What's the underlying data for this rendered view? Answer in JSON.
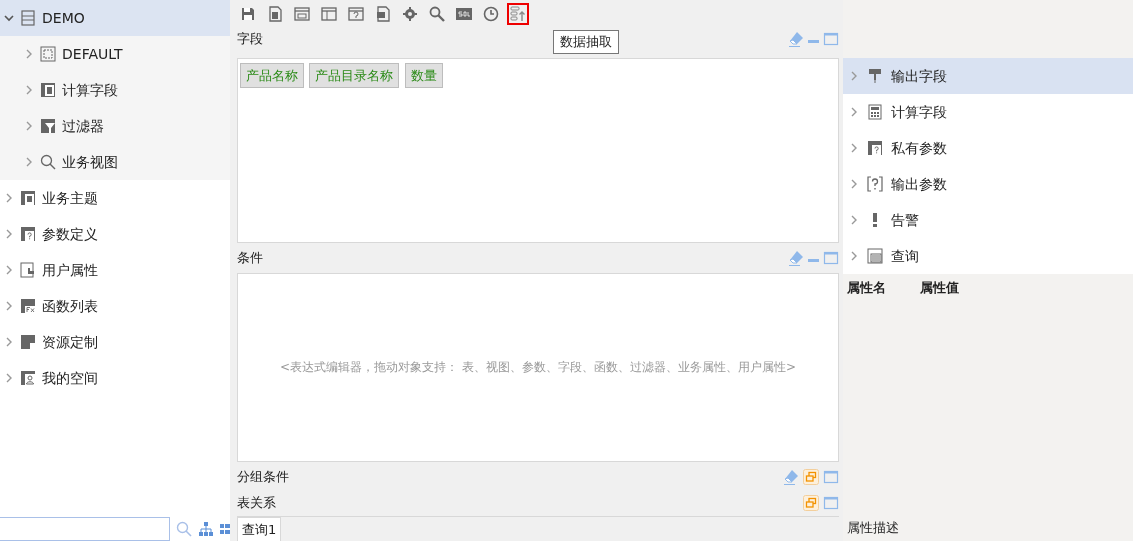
{
  "sidebar": {
    "tree": [
      {
        "label": "DEMO",
        "expanded": true,
        "selected": true,
        "children": [
          {
            "label": "DEFAULT",
            "expanded": false,
            "selected": false
          },
          {
            "label": "计算字段",
            "expanded": false,
            "selected": false
          },
          {
            "label": "过滤器",
            "expanded": false,
            "selected": false
          },
          {
            "label": "业务视图",
            "expanded": false,
            "selected": false
          }
        ]
      },
      {
        "label": "业务主题",
        "expanded": false,
        "selected": false
      },
      {
        "label": "参数定义",
        "expanded": false,
        "selected": false
      },
      {
        "label": "用户属性",
        "expanded": false,
        "selected": false
      },
      {
        "label": "函数列表",
        "expanded": false,
        "selected": false
      },
      {
        "label": "资源定制",
        "expanded": false,
        "selected": false
      },
      {
        "label": "我的空间",
        "expanded": false,
        "selected": false
      }
    ]
  },
  "toolbar": {
    "buttons": [
      {
        "highlighted": false
      },
      {
        "highlighted": false
      },
      {
        "highlighted": false
      },
      {
        "highlighted": false
      },
      {
        "highlighted": false
      },
      {
        "highlighted": false
      },
      {
        "highlighted": false
      },
      {
        "highlighted": false
      },
      {
        "highlighted": false
      },
      {
        "highlighted": false
      },
      {
        "highlighted": true
      }
    ],
    "tooltip": "数据抽取"
  },
  "panels": [
    {
      "kind": "chips",
      "title": "字段",
      "minimized": false,
      "chips": [
        "产品名称",
        "产品目录名称",
        "数量"
      ]
    },
    {
      "kind": "editor",
      "title": "条件",
      "minimized": false,
      "placeholder": "<表达式编辑器，拖动对象支持： 表、视图、参数、字段、函数、过滤器、业务属性、用户属性>"
    },
    {
      "kind": "collapsed",
      "title": "分组条件",
      "minimized": true
    },
    {
      "kind": "tabs",
      "title": "表关系",
      "minimized": true,
      "tabs": [
        "查询1"
      ]
    }
  ],
  "outline": {
    "items": [
      {
        "label": "输出字段",
        "selected": true
      },
      {
        "label": "计算字段",
        "selected": false
      },
      {
        "label": "私有参数",
        "selected": false
      },
      {
        "label": "输出参数",
        "selected": false
      },
      {
        "label": "告警",
        "selected": false
      },
      {
        "label": "查询",
        "selected": false
      }
    ]
  },
  "properties": {
    "columns": [
      "属性名",
      "属性值"
    ],
    "description_label": "属性描述"
  }
}
